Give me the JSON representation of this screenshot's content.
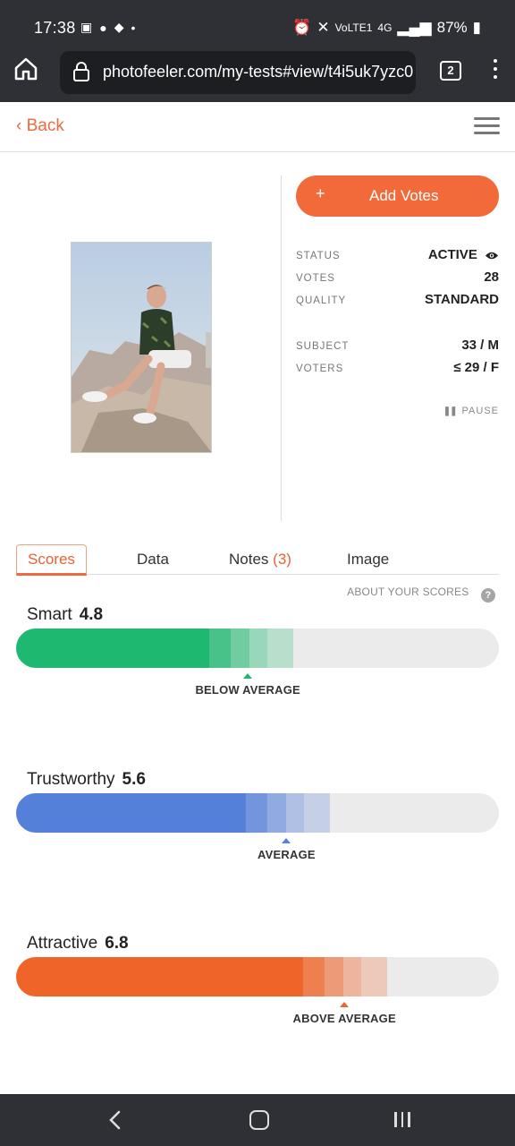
{
  "status_bar": {
    "time": "17:38",
    "battery": "87%",
    "network": "4G",
    "carrier_icon": "VoLTE1"
  },
  "browser": {
    "url": "photofeeler.com/my-tests#view/t4i5uk7yzc0",
    "tab_count": "2"
  },
  "header": {
    "back_label": "Back"
  },
  "test": {
    "add_votes_label": "Add Votes",
    "add_votes_icon": "+",
    "status_label": "STATUS",
    "status_value": "ACTIVE",
    "votes_label": "VOTES",
    "votes_value": "28",
    "quality_label": "QUALITY",
    "quality_value": "STANDARD",
    "subject_label": "SUBJECT",
    "subject_value": "33 / M",
    "voters_label": "VOTERS",
    "voters_value": "≤ 29 / F",
    "pause_label": "PAUSE"
  },
  "tabs": [
    {
      "label": "Scores"
    },
    {
      "label": "Data"
    },
    {
      "label": "Notes",
      "count": "(3)"
    },
    {
      "label": "Image"
    }
  ],
  "about_scores": "ABOUT YOUR SCORES",
  "scores": [
    {
      "name": "Smart",
      "value": "4.8",
      "rating": "BELOW AVERAGE",
      "color": "#1fb871",
      "fill": 0.4,
      "marker": 0.48
    },
    {
      "name": "Trustworthy",
      "value": "5.6",
      "rating": "AVERAGE",
      "color": "#5480d9",
      "fill": 0.475,
      "marker": 0.56
    },
    {
      "name": "Attractive",
      "value": "6.8",
      "rating": "ABOVE AVERAGE",
      "color": "#ef6529",
      "fill": 0.595,
      "marker": 0.68
    }
  ]
}
